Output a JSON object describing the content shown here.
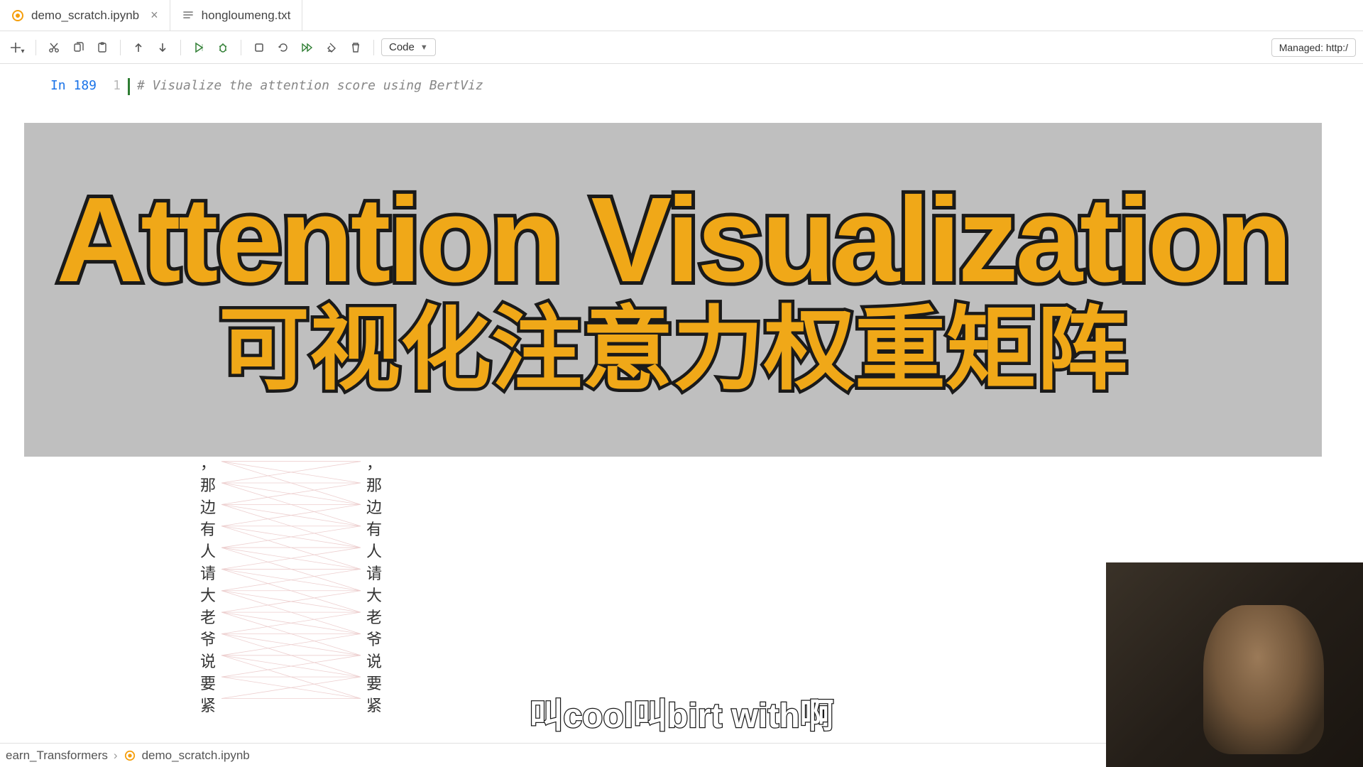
{
  "tabs": [
    {
      "label": "demo_scratch.ipynb",
      "icon": "notebook",
      "active": true
    },
    {
      "label": "hongloumeng.txt",
      "icon": "text",
      "active": false
    }
  ],
  "toolbar": {
    "cell_type": "Code",
    "managed": "Managed: http:/"
  },
  "cell": {
    "prompt": "In 189",
    "line_no": "1",
    "code": "# Visualize the attention score using BertViz"
  },
  "banner": {
    "line1": "Attention Visualization",
    "line2": "可视化注意力权重矩阵"
  },
  "attention_tokens": [
    "，",
    "那",
    "边",
    "有",
    "人",
    "请",
    "大",
    "老",
    "爷",
    "说",
    "要",
    "紧"
  ],
  "subtitle": "叫cool叫birt with啊",
  "breadcrumb": {
    "folder": "earn_Transformers",
    "file": "demo_scratch.ipynb"
  }
}
